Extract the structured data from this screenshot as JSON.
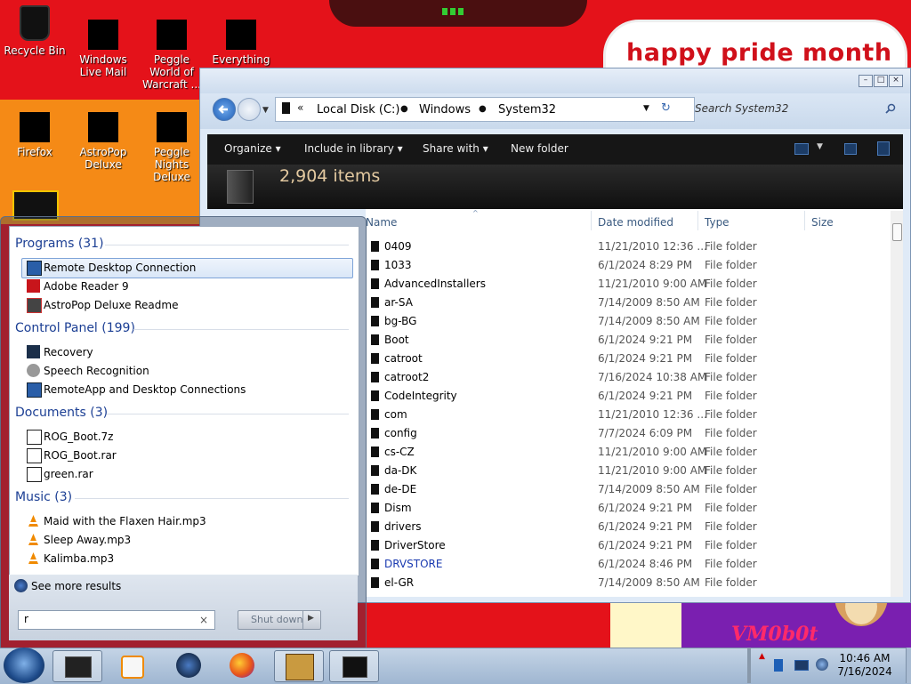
{
  "desktop": {
    "banner_text": "happy pride month",
    "icons": [
      {
        "label": "Recycle Bin"
      },
      {
        "label": "Windows Live Mail"
      },
      {
        "label": "Peggle World of Warcraft ..."
      },
      {
        "label": "Everything"
      },
      {
        "label": "Firefox"
      },
      {
        "label": "AstroPop Deluxe"
      },
      {
        "label": "Peggle Nights Deluxe"
      }
    ]
  },
  "explorer": {
    "breadcrumbs": [
      "Local Disk (C:)",
      "Windows",
      "System32"
    ],
    "search_placeholder": "Search System32",
    "toolbar": {
      "organize": "Organize",
      "include": "Include in library",
      "share": "Share with",
      "new_folder": "New folder"
    },
    "item_count": "2,904 items",
    "columns": {
      "name": "Name",
      "date": "Date modified",
      "type": "Type",
      "size": "Size"
    },
    "rows": [
      {
        "name": "0409",
        "date": "11/21/2010 12:36 ...",
        "type": "File folder"
      },
      {
        "name": "1033",
        "date": "6/1/2024 8:29 PM",
        "type": "File folder"
      },
      {
        "name": "AdvancedInstallers",
        "date": "11/21/2010 9:00 AM",
        "type": "File folder"
      },
      {
        "name": "ar-SA",
        "date": "7/14/2009 8:50 AM",
        "type": "File folder"
      },
      {
        "name": "bg-BG",
        "date": "7/14/2009 8:50 AM",
        "type": "File folder"
      },
      {
        "name": "Boot",
        "date": "6/1/2024 9:21 PM",
        "type": "File folder"
      },
      {
        "name": "catroot",
        "date": "6/1/2024 9:21 PM",
        "type": "File folder"
      },
      {
        "name": "catroot2",
        "date": "7/16/2024 10:38 AM",
        "type": "File folder"
      },
      {
        "name": "CodeIntegrity",
        "date": "6/1/2024 9:21 PM",
        "type": "File folder"
      },
      {
        "name": "com",
        "date": "11/21/2010 12:36 ...",
        "type": "File folder"
      },
      {
        "name": "config",
        "date": "7/7/2024 6:09 PM",
        "type": "File folder"
      },
      {
        "name": "cs-CZ",
        "date": "11/21/2010 9:00 AM",
        "type": "File folder"
      },
      {
        "name": "da-DK",
        "date": "11/21/2010 9:00 AM",
        "type": "File folder"
      },
      {
        "name": "de-DE",
        "date": "7/14/2009 8:50 AM",
        "type": "File folder"
      },
      {
        "name": "Dism",
        "date": "6/1/2024 9:21 PM",
        "type": "File folder"
      },
      {
        "name": "drivers",
        "date": "6/1/2024 9:21 PM",
        "type": "File folder"
      },
      {
        "name": "DriverStore",
        "date": "6/1/2024 9:21 PM",
        "type": "File folder"
      },
      {
        "name": "DRVSTORE",
        "date": "6/1/2024 8:46 PM",
        "type": "File folder"
      },
      {
        "name": "el-GR",
        "date": "7/14/2009 8:50 AM",
        "type": "File folder"
      }
    ]
  },
  "startmenu": {
    "programs": {
      "header": "Programs (31)",
      "items": [
        "Remote Desktop Connection",
        "Adobe Reader 9",
        "AstroPop Deluxe Readme"
      ]
    },
    "control_panel": {
      "header": "Control Panel (199)",
      "items": [
        "Recovery",
        "Speech Recognition",
        "RemoteApp and Desktop Connections"
      ]
    },
    "documents": {
      "header": "Documents (3)",
      "items": [
        "ROG_Boot.7z",
        "ROG_Boot.rar",
        "green.rar"
      ]
    },
    "music": {
      "header": "Music (3)",
      "items": [
        "Maid with the Flaxen Hair.mp3",
        "Sleep Away.mp3",
        "Kalimba.mp3"
      ]
    },
    "see_more": "See more results",
    "search_value": "r",
    "shutdown_label": "Shut down"
  },
  "taskbar": {
    "time": "10:46 AM",
    "date": "7/16/2024"
  }
}
